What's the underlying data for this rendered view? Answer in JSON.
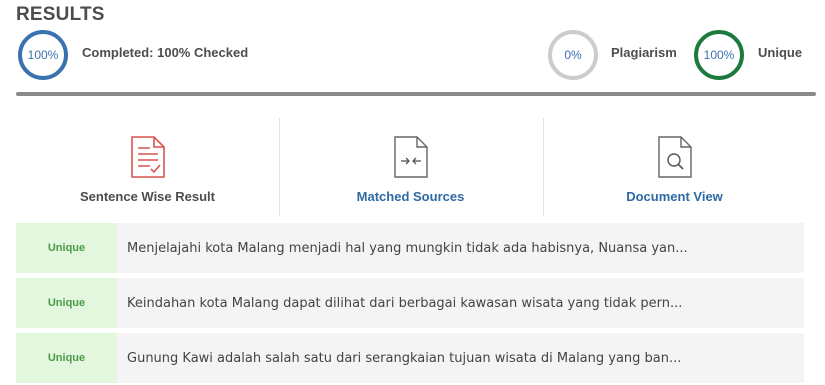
{
  "header": {
    "title": "RESULTS"
  },
  "summary": {
    "completed_percent": "100%",
    "completed_label": "Completed: 100% Checked",
    "plagiarism_percent": "0%",
    "plagiarism_label": "Plagiarism",
    "unique_percent": "100%",
    "unique_label": "Unique",
    "colors": {
      "completed": "#3a72b0",
      "plagiarism": "#cccccc",
      "unique": "#1d7a3e"
    }
  },
  "tabs": [
    {
      "label": "Sentence Wise Result",
      "icon": "document-check-icon"
    },
    {
      "label": "Matched Sources",
      "icon": "document-compare-icon"
    },
    {
      "label": "Document View",
      "icon": "document-search-icon"
    }
  ],
  "results": [
    {
      "status": "Unique",
      "text": "Menjelajahi kota Malang menjadi hal yang mungkin tidak ada habisnya, Nuansa yan..."
    },
    {
      "status": "Unique",
      "text": "Keindahan kota Malang dapat dilihat dari berbagai kawasan wisata yang tidak pern..."
    },
    {
      "status": "Unique",
      "text": "Gunung Kawi adalah salah satu dari serangkaian tujuan wisata di Malang yang ban..."
    }
  ]
}
